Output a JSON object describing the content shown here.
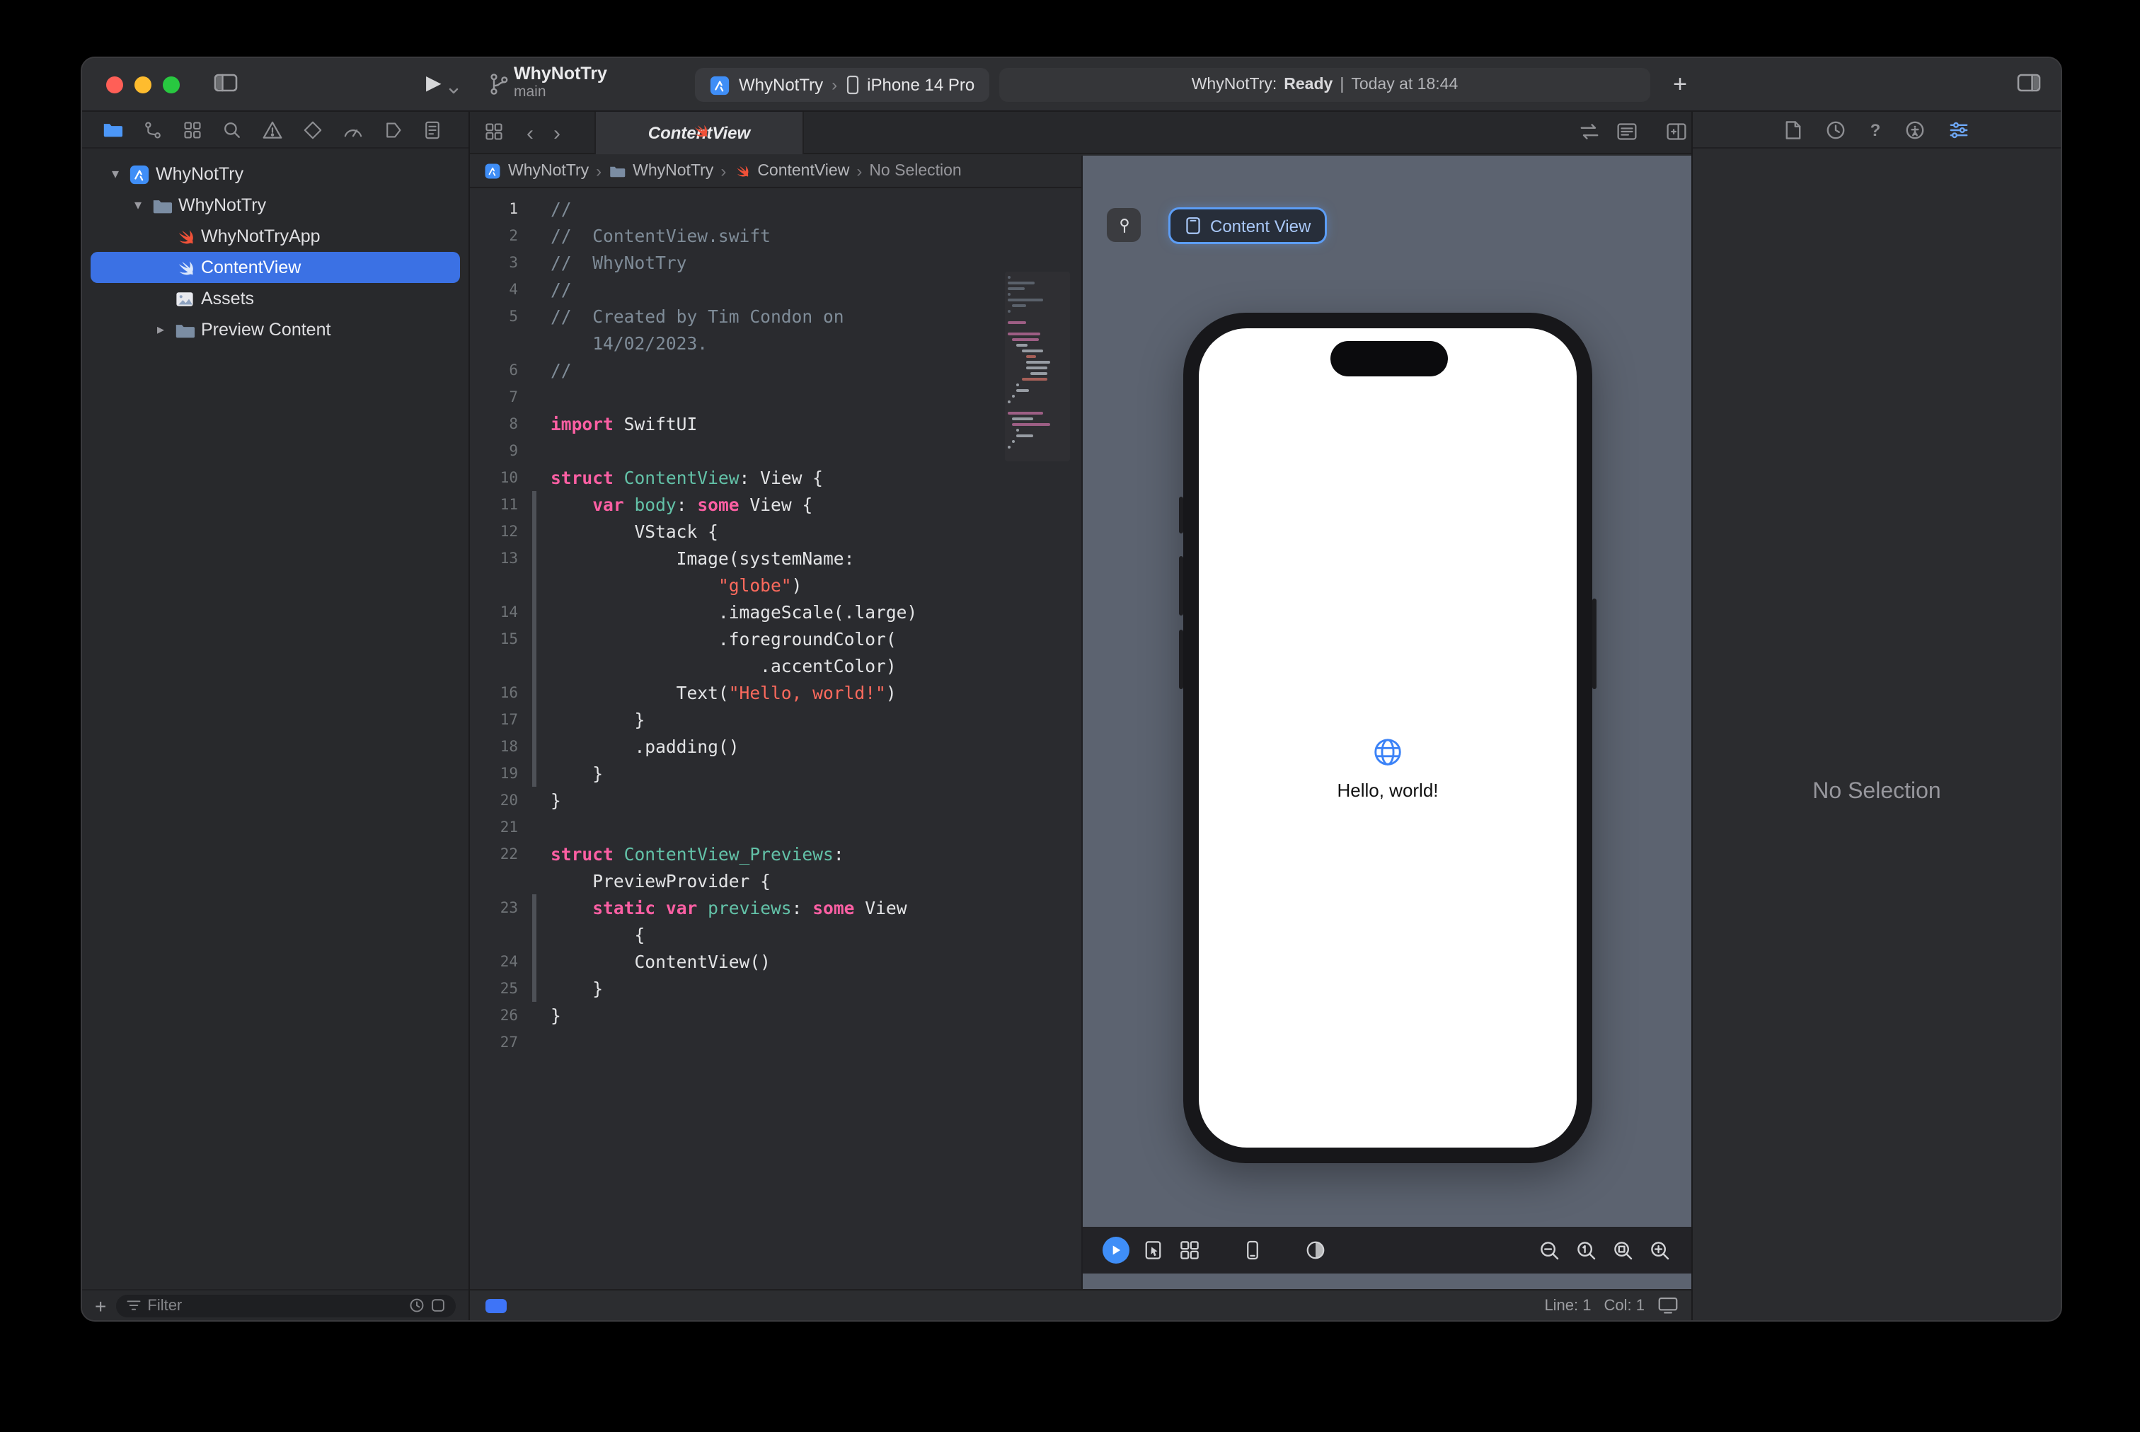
{
  "colors": {
    "selection_blue": "#3b71e4",
    "accent_blue": "#4c97f8",
    "canvas_background": "#5c6370",
    "swift_orange": "#f05138",
    "syntax_keyword": "#fc5fa3",
    "syntax_string": "#fc6a5d",
    "syntax_comment": "#7f8c98",
    "syntax_declaration": "#63c2a8",
    "syntax_plain": "#e3e4e6"
  },
  "icons": {
    "plus": "+",
    "back_chevron": "‹",
    "forward_chevron": "›",
    "chevron_separator": "›",
    "disclosure_open": "▾",
    "disclosure_closed": "▸",
    "run": "▶"
  },
  "titlebar": {
    "scheme_name": "WhyNotTry",
    "branch_name": "main",
    "destination_project": "WhyNotTry",
    "destination_device": "iPhone 14 Pro",
    "status_project": "WhyNotTry:",
    "status_state": "Ready",
    "status_separator": "|",
    "status_time": "Today at 18:44"
  },
  "sidebar": {
    "filter_placeholder": "Filter",
    "tree": [
      {
        "label": "WhyNotTry",
        "icon": "app",
        "level": 0,
        "disclosure": "open"
      },
      {
        "label": "WhyNotTry",
        "icon": "folder",
        "level": 1,
        "disclosure": "open"
      },
      {
        "label": "WhyNotTryApp",
        "icon": "swift",
        "level": 2
      },
      {
        "label": "ContentView",
        "icon": "swiftui",
        "level": 2,
        "selected": true
      },
      {
        "label": "Assets",
        "icon": "assets",
        "level": 2
      },
      {
        "label": "Preview Content",
        "icon": "folder",
        "level": 2,
        "disclosure": "closed"
      }
    ]
  },
  "tabbar": {
    "active_tab": "ContentView"
  },
  "jumpbar": {
    "items": [
      "WhyNotTry",
      "WhyNotTry",
      "ContentView",
      "No Selection"
    ]
  },
  "editor": {
    "status": {
      "line": "Line: 1",
      "col": "Col: 1"
    },
    "rows": [
      {
        "n": "1",
        "cur": 1,
        "t": [
          [
            "c",
            "//"
          ]
        ]
      },
      {
        "n": "2",
        "t": [
          [
            "c",
            "//  ContentView.swift"
          ]
        ]
      },
      {
        "n": "3",
        "t": [
          [
            "c",
            "//  WhyNotTry"
          ]
        ]
      },
      {
        "n": "4",
        "t": [
          [
            "c",
            "//"
          ]
        ]
      },
      {
        "n": "5",
        "t": [
          [
            "c",
            "//  Created by Tim Condon on"
          ]
        ]
      },
      {
        "n": "",
        "t": [
          [
            "c",
            "    14/02/2023."
          ]
        ]
      },
      {
        "n": "6",
        "t": [
          [
            "c",
            "//"
          ]
        ]
      },
      {
        "n": "7",
        "t": []
      },
      {
        "n": "8",
        "t": [
          [
            "k",
            "import"
          ],
          [
            "p",
            " SwiftUI"
          ]
        ]
      },
      {
        "n": "9",
        "t": []
      },
      {
        "n": "10",
        "t": [
          [
            "k",
            "struct"
          ],
          [
            "p",
            " "
          ],
          [
            "d",
            "ContentView"
          ],
          [
            "p",
            ": View {"
          ]
        ]
      },
      {
        "n": "11",
        "f": 1,
        "t": [
          [
            "p",
            "    "
          ],
          [
            "k",
            "var"
          ],
          [
            "p",
            " "
          ],
          [
            "d",
            "body"
          ],
          [
            "p",
            ": "
          ],
          [
            "k",
            "some"
          ],
          [
            "p",
            " View {"
          ]
        ]
      },
      {
        "n": "12",
        "f": 1,
        "t": [
          [
            "p",
            "        VStack {"
          ]
        ]
      },
      {
        "n": "13",
        "f": 1,
        "t": [
          [
            "p",
            "            Image(systemName:"
          ]
        ]
      },
      {
        "n": "",
        "f": 1,
        "t": [
          [
            "p",
            "                "
          ],
          [
            "s",
            "\"globe\""
          ],
          [
            "p",
            ")"
          ]
        ]
      },
      {
        "n": "14",
        "f": 1,
        "t": [
          [
            "p",
            "                .imageScale(.large)"
          ]
        ]
      },
      {
        "n": "15",
        "f": 1,
        "t": [
          [
            "p",
            "                .foregroundColor("
          ]
        ]
      },
      {
        "n": "",
        "f": 1,
        "t": [
          [
            "p",
            "                    .accentColor)"
          ]
        ]
      },
      {
        "n": "16",
        "f": 1,
        "t": [
          [
            "p",
            "            Text("
          ],
          [
            "s",
            "\"Hello, world!\""
          ],
          [
            "p",
            ")"
          ]
        ]
      },
      {
        "n": "17",
        "f": 1,
        "t": [
          [
            "p",
            "        }"
          ]
        ]
      },
      {
        "n": "18",
        "f": 1,
        "t": [
          [
            "p",
            "        .padding()"
          ]
        ]
      },
      {
        "n": "19",
        "f": 1,
        "t": [
          [
            "p",
            "    }"
          ]
        ]
      },
      {
        "n": "20",
        "t": [
          [
            "p",
            "}"
          ]
        ]
      },
      {
        "n": "21",
        "t": []
      },
      {
        "n": "22",
        "t": [
          [
            "k",
            "struct"
          ],
          [
            "p",
            " "
          ],
          [
            "d",
            "ContentView_Previews"
          ],
          [
            "p",
            ":"
          ]
        ]
      },
      {
        "n": "",
        "t": [
          [
            "p",
            "    PreviewProvider {"
          ]
        ]
      },
      {
        "n": "23",
        "f": 1,
        "t": [
          [
            "p",
            "    "
          ],
          [
            "k",
            "static"
          ],
          [
            "p",
            " "
          ],
          [
            "k",
            "var"
          ],
          [
            "p",
            " "
          ],
          [
            "d",
            "previews"
          ],
          [
            "p",
            ": "
          ],
          [
            "k",
            "some"
          ],
          [
            "p",
            " View"
          ]
        ]
      },
      {
        "n": "",
        "f": 1,
        "t": [
          [
            "p",
            "        {"
          ]
        ]
      },
      {
        "n": "24",
        "f": 1,
        "t": [
          [
            "p",
            "        ContentView()"
          ]
        ]
      },
      {
        "n": "25",
        "f": 1,
        "t": [
          [
            "p",
            "    }"
          ]
        ]
      },
      {
        "n": "26",
        "t": [
          [
            "p",
            "}"
          ]
        ]
      },
      {
        "n": "27",
        "t": []
      }
    ]
  },
  "canvas": {
    "preview_chip": "Content View",
    "hello_text": "Hello, world!"
  },
  "inspector": {
    "empty_text": "No Selection"
  }
}
